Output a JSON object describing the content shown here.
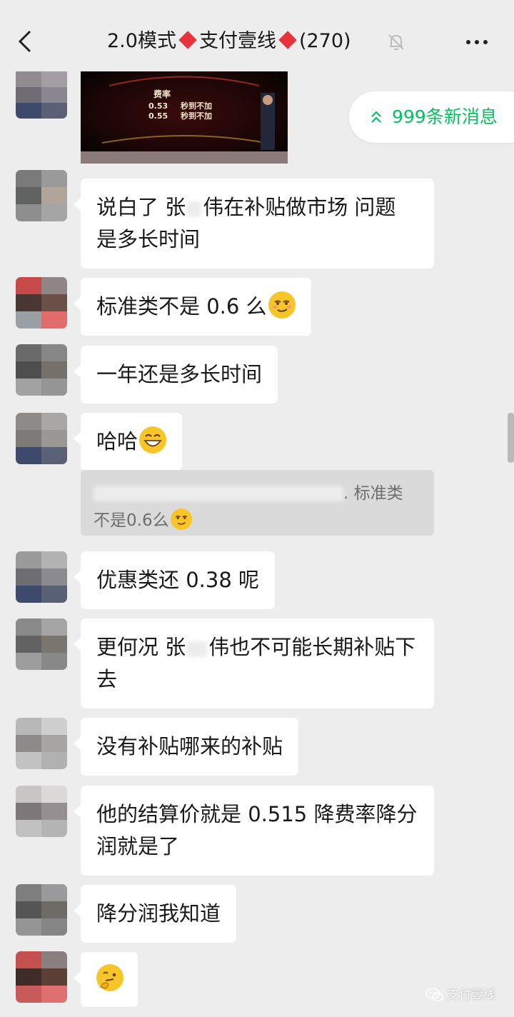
{
  "header": {
    "title_prefix": "2.0模式",
    "title_name": "支付壹线",
    "member_count": "(270)"
  },
  "image_message": {
    "heading": "费率",
    "row1_rate": "0.53",
    "row1_text": "秒到不加",
    "row2_rate": "0.55",
    "row2_text": "秒到不加"
  },
  "new_messages": {
    "label": "999条新消息"
  },
  "messages": [
    {
      "line1": "说白了 张",
      "line1b": "伟在补贴做市场 问题",
      "line2": "是多长时间"
    },
    {
      "text": "标准类不是 0.6 么",
      "emoji": "smirk-emoji"
    },
    {
      "text": "一年还是多长时间"
    },
    {
      "text": "哈哈",
      "emoji": "grin-emoji"
    },
    {
      "text": "优惠类还 0.38 呢"
    },
    {
      "line1": "更何况 张",
      "line1b": "伟也不可能长期补贴下",
      "line2": "去"
    },
    {
      "text": "没有补贴哪来的补贴"
    },
    {
      "line1": "他的结算价就是 0.515 降费率降分",
      "line2": "润就是了"
    },
    {
      "text": "降分润我知道"
    },
    {
      "emoji": "thinking-emoji"
    }
  ],
  "quote": {
    "line1_end": ". 标准类",
    "line2": "不是0.6么"
  },
  "watermark": {
    "text": "支付壹线"
  },
  "colors": {
    "accent": "#07c160",
    "diamond": "#e8333c",
    "background": "#ededed"
  }
}
